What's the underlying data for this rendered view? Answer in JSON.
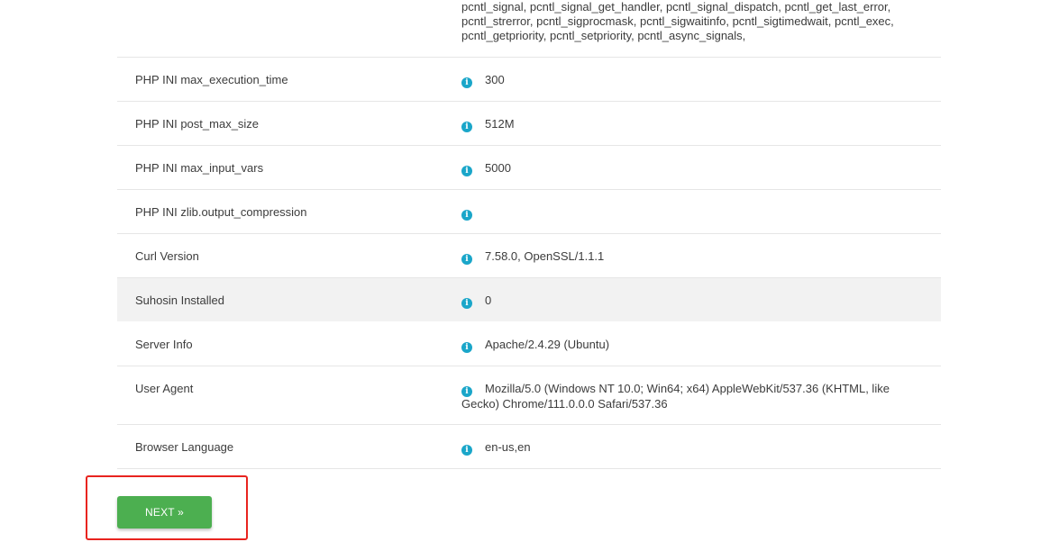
{
  "top_continuation": [
    "pcntl_signal, pcntl_signal_get_handler, pcntl_signal_dispatch, pcntl_get_last_error,",
    "pcntl_strerror, pcntl_sigprocmask, pcntl_sigwaitinfo, pcntl_sigtimedwait, pcntl_exec,",
    "pcntl_getpriority, pcntl_setpriority, pcntl_async_signals,"
  ],
  "rows": [
    {
      "label": "PHP INI max_execution_time",
      "value": "300"
    },
    {
      "label": "PHP INI post_max_size",
      "value": "512M"
    },
    {
      "label": "PHP INI max_input_vars",
      "value": "5000"
    },
    {
      "label": "PHP INI zlib.output_compression",
      "value": ""
    },
    {
      "label": "Curl Version",
      "value": "7.58.0, OpenSSL/1.1.1"
    },
    {
      "label": "Suhosin Installed",
      "value": "0"
    },
    {
      "label": "Server Info",
      "value": "Apache/2.4.29 (Ubuntu)"
    },
    {
      "label": "User Agent",
      "value": "Mozilla/5.0 (Windows NT 10.0; Win64; x64) AppleWebKit/537.36 (KHTML, like Gecko) Chrome/111.0.0.0 Safari/537.36"
    },
    {
      "label": "Browser Language",
      "value": "en-us,en"
    }
  ],
  "info_icon": "i",
  "next_button": "NEXT »",
  "colors": {
    "accent": "#1aa6c9",
    "button": "#4caf50",
    "highlight": "#e8241f",
    "row_highlight": "#f2f2f2"
  }
}
